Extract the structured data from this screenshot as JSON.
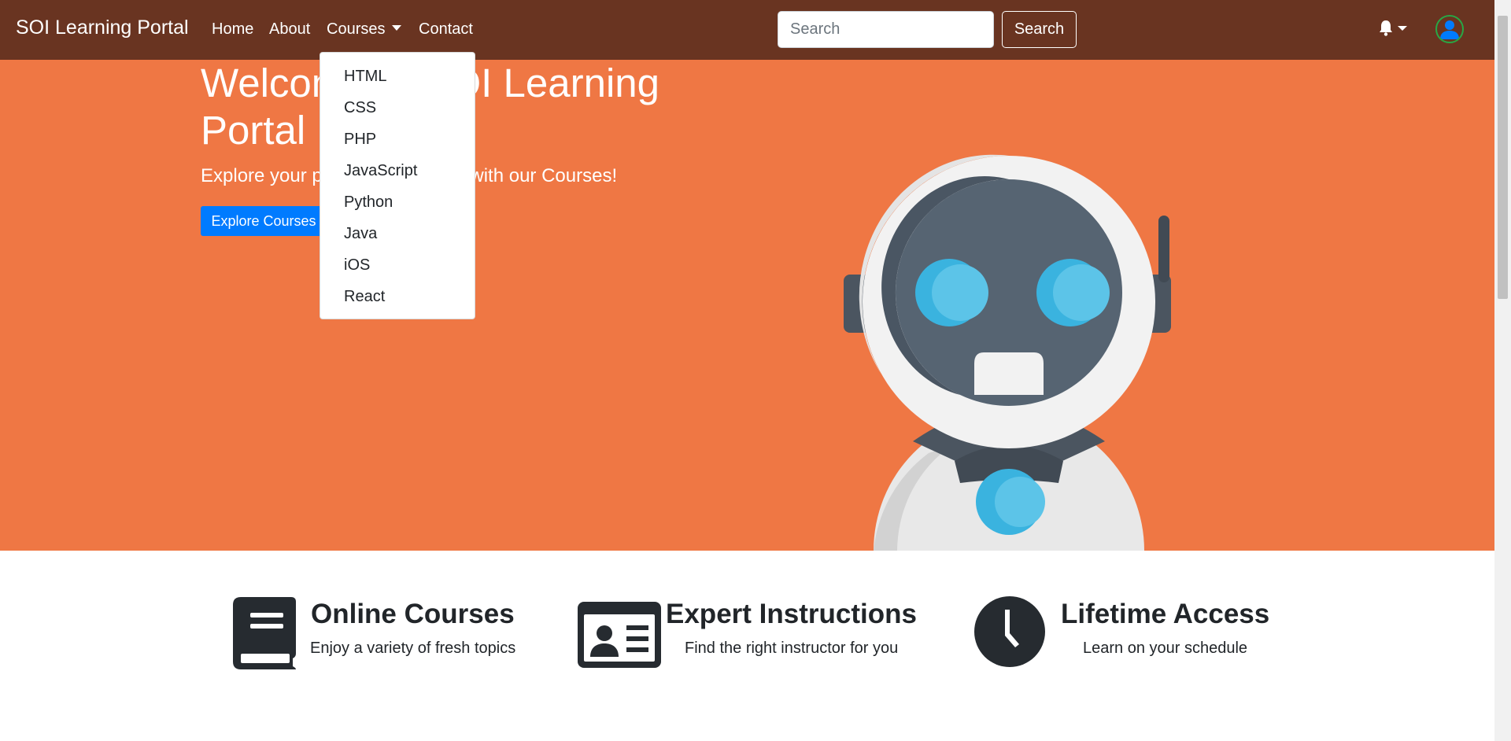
{
  "navbar": {
    "brand": "SOI Learning Portal",
    "links": [
      "Home",
      "About",
      "Courses",
      "Contact"
    ],
    "search_placeholder": "Search",
    "search_button": "Search"
  },
  "courses_menu": [
    "HTML",
    "CSS",
    "PHP",
    "JavaScript",
    "Python",
    "Java",
    "iOS",
    "React"
  ],
  "hero": {
    "title": "Welcome to SOI Learning Portal",
    "subtitle": "Explore your passion in IT Field with our Courses!",
    "cta": "Explore Courses"
  },
  "features": [
    {
      "icon": "book-icon",
      "title": "Online Courses",
      "description": "Enjoy a variety of fresh topics"
    },
    {
      "icon": "id-card-icon",
      "title": "Expert Instructions",
      "description": "Find the right instructor for you"
    },
    {
      "icon": "clock-icon",
      "title": "Lifetime Access",
      "description": "Learn on your schedule"
    }
  ],
  "colors": {
    "navbar_bg": "#693421",
    "hero_bg": "#ef7744",
    "primary_button": "#007bff",
    "avatar_ring": "#28a745"
  }
}
